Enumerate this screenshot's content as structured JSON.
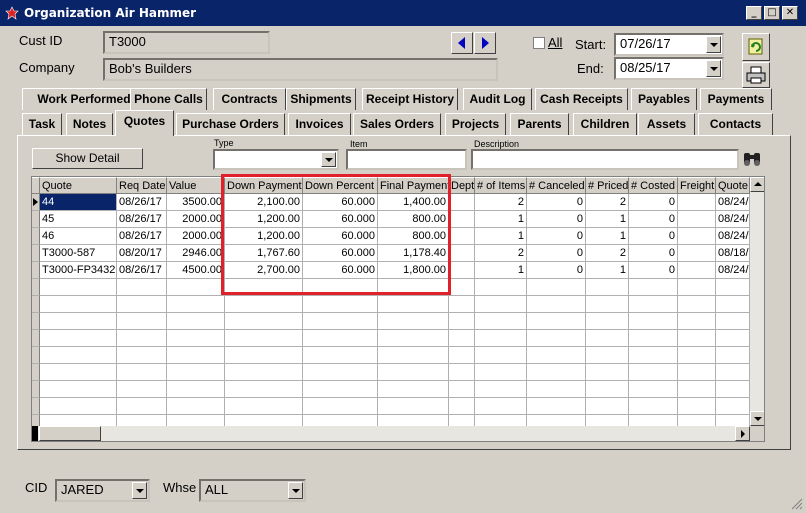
{
  "window": {
    "title": "Organization Air Hammer"
  },
  "header": {
    "cust_id_label": "Cust ID",
    "cust_id_value": "T3000",
    "company_label": "Company",
    "company_value": "Bob's Builders",
    "all_label": "All",
    "all_checked": false,
    "start_label": "Start:",
    "start_value": "07/26/17",
    "end_label": "End:",
    "end_value": "08/25/17"
  },
  "tabs_row1": [
    "Work Performed",
    "Phone Calls",
    "Contracts",
    "Shipments",
    "Receipt History",
    "Audit Log",
    "Cash Receipts",
    "Payables",
    "Payments"
  ],
  "tabs_row2": [
    "Task",
    "Notes",
    "Quotes",
    "Purchase Orders",
    "Invoices",
    "Sales Orders",
    "Projects",
    "Parents",
    "Children",
    "Assets",
    "Contacts"
  ],
  "active_tab": "Quotes",
  "filters": {
    "show_detail_label": "Show Detail",
    "type_label": "Type",
    "type_value": "",
    "item_label": "Item",
    "item_value": "",
    "description_label": "Description",
    "description_value": ""
  },
  "table": {
    "columns": [
      "Quote",
      "Req Date",
      "Value",
      "Down Payment",
      "Down Percent",
      "Final Payment",
      "Dept",
      "# of Items",
      "# Canceled",
      "# Priced",
      "# Costed",
      "Freight",
      "Quote"
    ],
    "rows": [
      [
        "44",
        "08/26/17",
        "3500.00",
        "2,100.00",
        "60.000",
        "1,400.00",
        "",
        "2",
        "0",
        "2",
        "0",
        "",
        "08/24/"
      ],
      [
        "45",
        "08/26/17",
        "2000.00",
        "1,200.00",
        "60.000",
        "800.00",
        "",
        "1",
        "0",
        "1",
        "0",
        "",
        "08/24/"
      ],
      [
        "46",
        "08/26/17",
        "2000.00",
        "1,200.00",
        "60.000",
        "800.00",
        "",
        "1",
        "0",
        "1",
        "0",
        "",
        "08/24/"
      ],
      [
        "T3000-587",
        "08/20/17",
        "2946.00",
        "1,767.60",
        "60.000",
        "1,178.40",
        "",
        "2",
        "0",
        "2",
        "0",
        "",
        "08/18/"
      ],
      [
        "T3000-FP3432",
        "08/26/17",
        "4500.00",
        "2,700.00",
        "60.000",
        "1,800.00",
        "",
        "1",
        "0",
        "1",
        "0",
        "",
        "08/24/"
      ]
    ],
    "selected_row": 0
  },
  "footer": {
    "cid_label": "CID",
    "cid_value": "JARED",
    "whse_label": "Whse",
    "whse_value": "ALL"
  },
  "colors": {
    "titlebar": "#0a246a",
    "highlight_box": "#e0202a",
    "window_bg": "#d4d0c8"
  },
  "icons": [
    "app-icon",
    "minimize-icon",
    "maximize-icon",
    "close-icon",
    "nav-prev-icon",
    "nav-next-icon",
    "refresh-icon",
    "print-icon",
    "binoculars-icon"
  ]
}
